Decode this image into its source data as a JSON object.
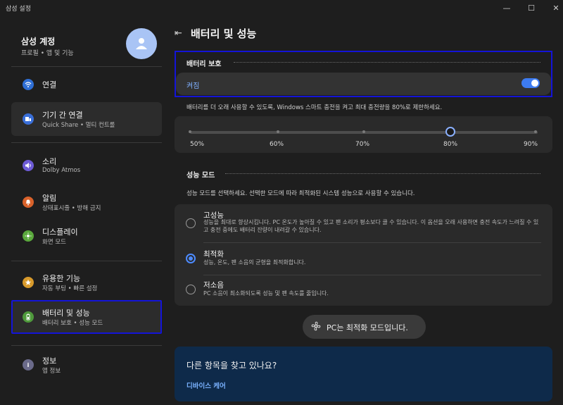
{
  "window": {
    "title": "삼성 설정",
    "minimize": "—",
    "maximize": "☐",
    "close": "✕"
  },
  "profile": {
    "name": "삼성 계정",
    "subtitle": "프로필 • 앱 및 기능"
  },
  "sidebar": {
    "items": [
      {
        "label": "연결",
        "desc": "",
        "color": "#2f6fd6",
        "icon": "wifi-icon"
      },
      {
        "label": "기기 간 연결",
        "desc": "Quick Share • 멀티 컨트롤",
        "color": "#3a6fd8",
        "icon": "devices-icon"
      },
      {
        "label": "소리",
        "desc": "Dolby Atmos",
        "color": "#6d5bd6",
        "icon": "speaker-icon"
      },
      {
        "label": "알림",
        "desc": "상태표시줄 • 방해 금지",
        "color": "#d9622b",
        "icon": "bell-icon"
      },
      {
        "label": "디스플레이",
        "desc": "화면 모드",
        "color": "#5aa83c",
        "icon": "sun-icon"
      },
      {
        "label": "유용한 기능",
        "desc": "자동 부팅 • 빠른 설정",
        "color": "#d89a2b",
        "icon": "star-icon"
      },
      {
        "label": "배터리 및 성능",
        "desc": "배터리 보호 • 성능 모드",
        "color": "#4f9a3c",
        "icon": "battery-icon"
      },
      {
        "label": "정보",
        "desc": "앱 정보",
        "color": "#6a6a8a",
        "icon": "info-icon"
      }
    ]
  },
  "main": {
    "back": "⇤",
    "title": "배터리 및 성능",
    "battery": {
      "heading": "배터리 보호",
      "toggle_label": "켜짐",
      "toggle_on": true,
      "info": "배터리를 더 오래 사용할 수 있도록, Windows 스마트 충전을 켜고 최대 충전량을 80%로 제한하세요.",
      "levels": [
        "50%",
        "60%",
        "70%",
        "80%",
        "90%"
      ],
      "selected_level": "80%"
    },
    "performance": {
      "heading": "성능 모드",
      "info": "성능 모드를 선택하세요. 선택한 모드에 따라 최적화된 시스템 성능으로 사용할 수 있습니다.",
      "modes": [
        {
          "title": "고성능",
          "desc": "성능을 최대로 향상시킵니다. PC 온도가 높아질 수 있고 팬 소리가 평소보다 클 수 있습니다. 이 옵션을 오래 사용하면 충전 속도가 느려질 수 있고 충전 중에도 배터리 잔량이 내려갈 수 있습니다.",
          "selected": false
        },
        {
          "title": "최적화",
          "desc": "성능, 온도, 팬 소음의 균형을 최적화합니다.",
          "selected": true
        },
        {
          "title": "저소음",
          "desc": "PC 소음이 최소화되도록 성능 및 팬 속도를 줄입니다.",
          "selected": false
        }
      ]
    },
    "status_pill": "PC는 최적화 모드입니다.",
    "find": {
      "question": "다른 항목을 찾고 있나요?",
      "link": "디바이스 케어"
    }
  }
}
